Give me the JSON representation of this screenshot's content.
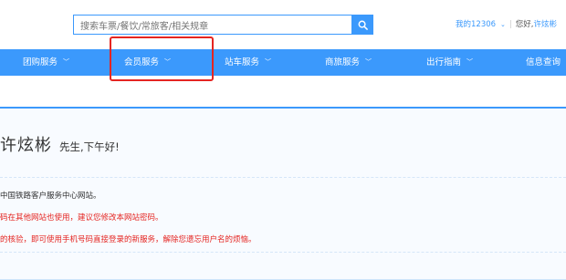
{
  "search": {
    "placeholder": "搜索车票/餐饮/常旅客/相关规章"
  },
  "toplinks": {
    "my12306": "我的12306",
    "separator": "|",
    "greeting": "您好,",
    "user": "许炫彬"
  },
  "nav": {
    "items": [
      {
        "label": "团购服务"
      },
      {
        "label": "会员服务"
      },
      {
        "label": "站车服务"
      },
      {
        "label": "商旅服务"
      },
      {
        "label": "出行指南"
      },
      {
        "label": "信息查询"
      }
    ]
  },
  "welcome": {
    "name": "许炫彬",
    "salutation": "先生,下午好!"
  },
  "messages": {
    "line1": "中国铁路客户服务中心网站。",
    "line2": "码在其他网站也使用，建议您修改本网站密码。",
    "line3": "的核验，即可使用手机号码直接登录的新服务，解除您遗忘用户名的烦恼。"
  },
  "colors": {
    "brand_blue": "#3b99fc",
    "highlight_red": "#e52521",
    "warning_red": "#e52521"
  }
}
